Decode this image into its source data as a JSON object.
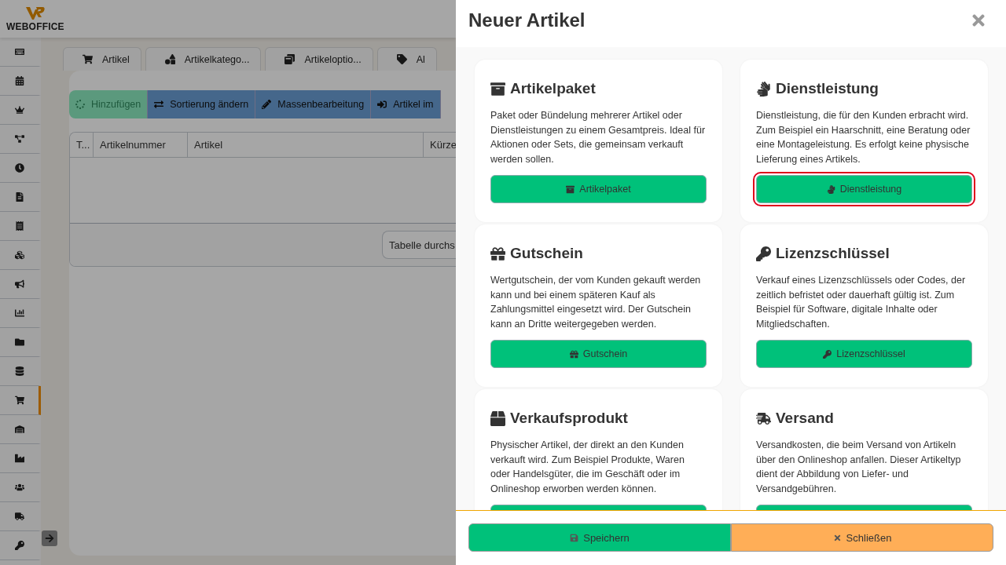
{
  "app": {
    "logo": "WEBOFFICE"
  },
  "sidebar": {
    "items": [
      {
        "selected": false
      },
      {
        "selected": false
      },
      {
        "selected": false
      },
      {
        "selected": false
      },
      {
        "selected": false
      },
      {
        "selected": false
      },
      {
        "selected": false
      },
      {
        "selected": false
      },
      {
        "selected": false
      },
      {
        "selected": false
      },
      {
        "selected": false
      },
      {
        "selected": false
      },
      {
        "selected": true
      },
      {
        "selected": false
      },
      {
        "selected": false
      },
      {
        "selected": false
      },
      {
        "selected": false
      },
      {
        "selected": false
      }
    ]
  },
  "tabs": [
    {
      "label": "Artikel",
      "kind": "cart"
    },
    {
      "label": "Artikelkatego...",
      "kind": "shapes"
    },
    {
      "label": "Artikeloptio...",
      "kind": "options"
    },
    {
      "label": "Al",
      "kind": "tag"
    }
  ],
  "toolbar": [
    {
      "label": "Hinzufügen",
      "kind": "add",
      "disabled": true
    },
    {
      "label": "Sortierung ändern",
      "kind": "sort",
      "disabled": false
    },
    {
      "label": "Massenbearbeitung",
      "kind": "edit",
      "disabled": false
    },
    {
      "label": "Artikel im",
      "kind": "import",
      "disabled": false
    }
  ],
  "table": {
    "columns": [
      "T...",
      "Artikelnummer",
      "Artikel",
      "Kürze"
    ]
  },
  "search": {
    "placeholder": "Tabelle durchs"
  },
  "dialog": {
    "title": "Neuer Artikel",
    "cards": [
      {
        "kind": "bundle",
        "title": "Artikelpaket",
        "description": "Paket oder Bündelung mehrerer Artikel oder Dienstleistungen zu einem Gesamtpreis. Ideal für Aktionen oder Sets, die gemeinsam verkauft werden sollen.",
        "button": "Artikelpaket",
        "focused": false
      },
      {
        "kind": "service",
        "title": "Dienstleistung",
        "description": "Dienstleistung, die für den Kunden erbracht wird. Zum Beispiel ein Haarschnitt, eine Beratung oder eine Montageleistung. Es erfolgt keine physische Lieferung eines Artikels.",
        "button": "Dienstleistung",
        "focused": true
      },
      {
        "kind": "voucher",
        "title": "Gutschein",
        "description": "Wertgutschein, der vom Kunden gekauft werden kann und bei einem späteren Kauf als Zahlungsmittel eingesetzt wird. Der Gutschein kann an Dritte weitergegeben werden.",
        "button": "Gutschein",
        "focused": false
      },
      {
        "kind": "license",
        "title": "Lizenzschlüssel",
        "description": "Verkauf eines Lizenzschlüssels oder Codes, der zeitlich befristet oder dauerhaft gültig ist. Zum Beispiel für Software, digitale Inhalte oder Mitgliedschaften.",
        "button": "Lizenzschlüssel",
        "focused": false
      },
      {
        "kind": "product",
        "title": "Verkaufsprodukt",
        "description": "Physischer Artikel, der direkt an den Kunden verkauft wird. Zum Beispiel Produkte, Waren oder Handelsgüter, die im Geschäft oder im Onlineshop erworben werden können.",
        "focused": false
      },
      {
        "kind": "shipping",
        "title": "Versand",
        "description": "Versandkosten, die beim Versand von Artikeln über den Onlineshop anfallen. Dieser Artikeltyp dient der Abbildung von Liefer- und Versandgebühren.",
        "focused": false
      }
    ],
    "buttons": [
      {
        "kind": "save",
        "label": "Speichern"
      },
      {
        "kind": "close",
        "label": "Schließen"
      }
    ]
  }
}
